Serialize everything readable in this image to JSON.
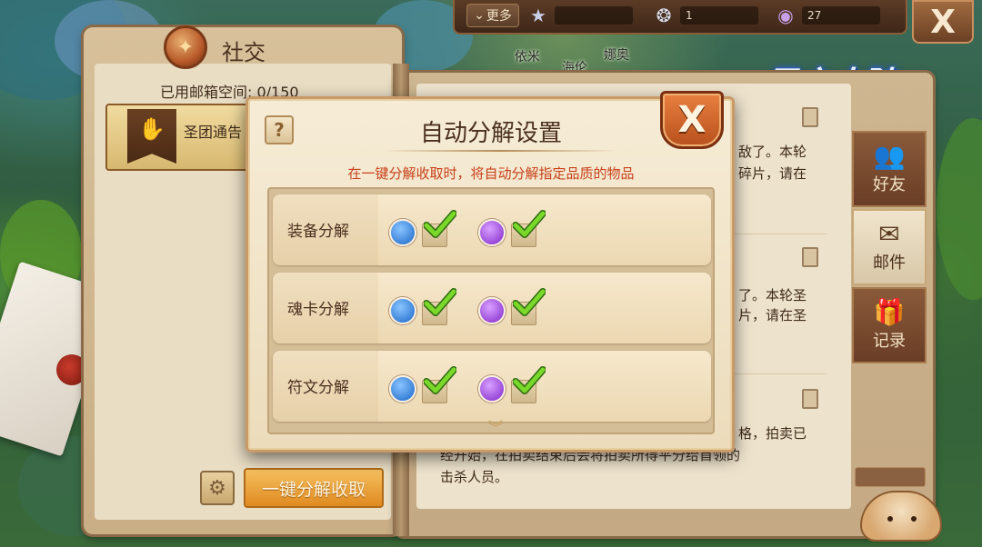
{
  "top_bar": {
    "more_label": "更多",
    "more_icon": "chevron-down-icon",
    "resources": [
      {
        "icon": "star-icon",
        "value": ""
      },
      {
        "icon": "shell-icon",
        "value": "1"
      },
      {
        "icon": "pearl-icon",
        "value": "27"
      }
    ],
    "close_label": "X"
  },
  "map_labels": [
    "依米",
    "海伦",
    "娜奥"
  ],
  "logo_text": "风之大陆",
  "social_panel": {
    "title": "社交",
    "mailbox_usage": "已用邮箱空间: 0/150",
    "guild_mail_label": "圣团通告",
    "claim_all_label": "一键分解收取"
  },
  "mail_items": [
    {
      "line1": "敌了。本轮",
      "line2": "碎片，请在"
    },
    {
      "line1": "了。本轮圣",
      "line2": "片，请在圣"
    },
    {
      "line1": "格，拍卖已",
      "line2": "经开始，在拍卖结束后会将拍卖所得平分给首领的",
      "line3": "击杀人员。"
    }
  ],
  "side_tabs": [
    {
      "label": "好友",
      "icon": "friends-icon",
      "active": false
    },
    {
      "label": "邮件",
      "icon": "mail-icon",
      "active": true
    },
    {
      "label": "记录",
      "icon": "gift-icon",
      "active": false
    }
  ],
  "dialog": {
    "title": "自动分解设置",
    "help_label": "?",
    "close_label": "X",
    "hint": "在一键分解收取时，将自动分解指定品质的物品",
    "options": [
      {
        "label": "装备分解",
        "blue_checked": true,
        "purple_checked": true
      },
      {
        "label": "魂卡分解",
        "blue_checked": true,
        "purple_checked": true
      },
      {
        "label": "符文分解",
        "blue_checked": true,
        "purple_checked": true
      }
    ],
    "quality_colors": {
      "blue": "#3a82d8",
      "purple": "#9a4ad8"
    }
  }
}
